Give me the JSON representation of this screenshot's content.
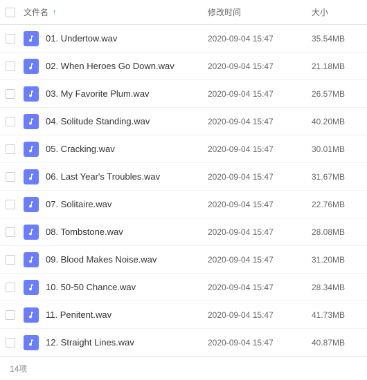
{
  "columns": {
    "name": "文件名",
    "time": "修改时间",
    "size": "大小"
  },
  "files": [
    {
      "name": "01. Undertow.wav",
      "time": "2020-09-04 15:47",
      "size": "35.54MB"
    },
    {
      "name": "02. When Heroes Go Down.wav",
      "time": "2020-09-04 15:47",
      "size": "21.18MB"
    },
    {
      "name": "03. My Favorite Plum.wav",
      "time": "2020-09-04 15:47",
      "size": "26.57MB"
    },
    {
      "name": "04. Solitude Standing.wav",
      "time": "2020-09-04 15:47",
      "size": "40.20MB"
    },
    {
      "name": "05. Cracking.wav",
      "time": "2020-09-04 15:47",
      "size": "30.01MB"
    },
    {
      "name": "06. Last Year's Troubles.wav",
      "time": "2020-09-04 15:47",
      "size": "31.67MB"
    },
    {
      "name": "07. Solitaire.wav",
      "time": "2020-09-04 15:47",
      "size": "22.76MB"
    },
    {
      "name": "08. Tombstone.wav",
      "time": "2020-09-04 15:47",
      "size": "28.08MB"
    },
    {
      "name": "09. Blood Makes Noise.wav",
      "time": "2020-09-04 15:47",
      "size": "31.20MB"
    },
    {
      "name": "10. 50-50 Chance.wav",
      "time": "2020-09-04 15:47",
      "size": "28.34MB"
    },
    {
      "name": "11. Penitent.wav",
      "time": "2020-09-04 15:47",
      "size": "41.73MB"
    },
    {
      "name": "12. Straight Lines.wav",
      "time": "2020-09-04 15:47",
      "size": "40.87MB"
    }
  ],
  "footer": "14项"
}
